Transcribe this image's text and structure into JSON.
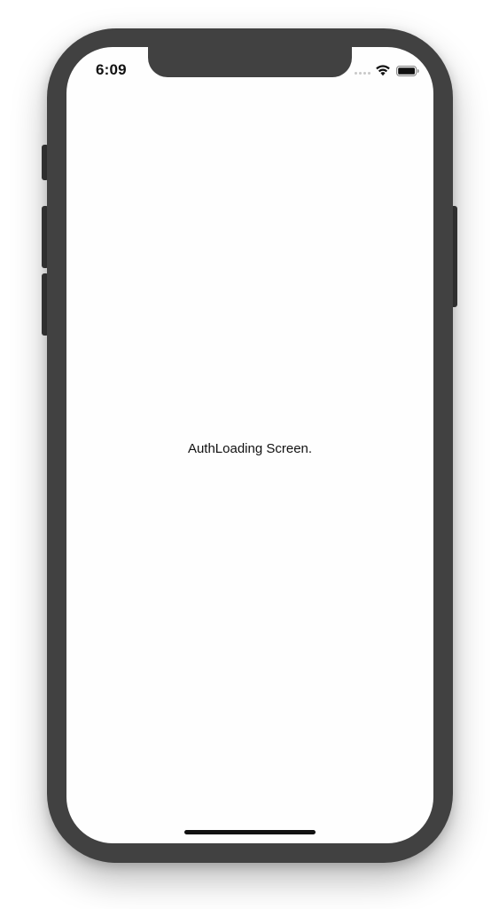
{
  "status_bar": {
    "time": "6:09"
  },
  "screen": {
    "message": "AuthLoading Screen."
  },
  "icons": {
    "signal": "cellular-signal-icon",
    "wifi": "wifi-icon",
    "battery": "battery-icon"
  },
  "colors": {
    "device_frame": "#414141",
    "screen_background": "#fefefe",
    "text": "#111111"
  }
}
